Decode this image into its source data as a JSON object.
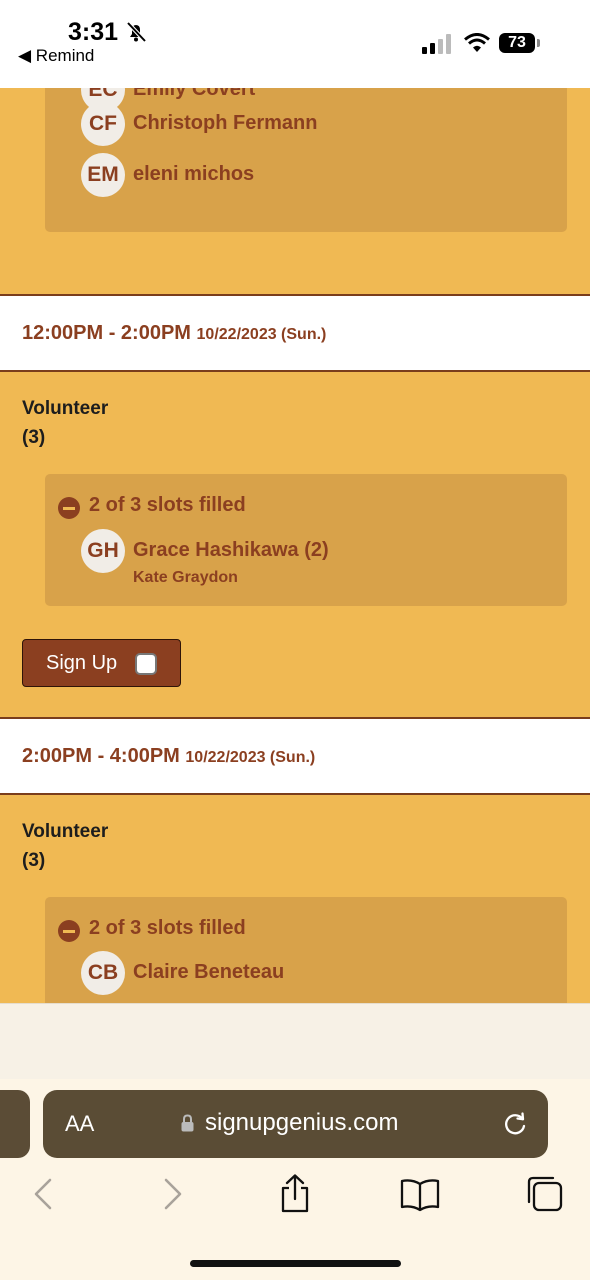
{
  "status_bar": {
    "time": "3:31",
    "back_app": "◀ Remind",
    "battery": "73"
  },
  "top_section": {
    "people": [
      {
        "initials": "EC",
        "name": "Emily Covert"
      },
      {
        "initials": "CF",
        "name": "Christoph Fermann"
      },
      {
        "initials": "EM",
        "name": "eleni michos"
      }
    ]
  },
  "slot1": {
    "time": "12:00PM - 2:00PM",
    "date": "10/22/2023 (Sun.)",
    "role": "Volunteer",
    "count": "(3)",
    "slots_filled": "2 of 3 slots filled",
    "person_initials": "GH",
    "person_name": "Grace Hashikawa (2)",
    "sub_name": "Kate Graydon",
    "signup_label": "Sign Up"
  },
  "slot2": {
    "time": "2:00PM - 4:00PM",
    "date": "10/22/2023 (Sun.)",
    "role": "Volunteer",
    "count": "(3)",
    "slots_filled": "2 of 3 slots filled",
    "person_initials": "CB",
    "person_name": "Claire Beneteau"
  },
  "browser": {
    "aa_label": "AA",
    "url": "signupgenius.com"
  },
  "colors": {
    "accent": "#8b3f20",
    "background": "#f0b953",
    "card": "#d8a24a"
  }
}
